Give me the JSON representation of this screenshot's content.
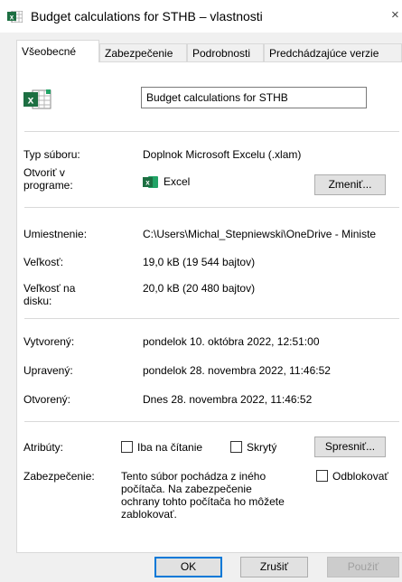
{
  "window": {
    "title": "Budget calculations for STHB – vlastnosti",
    "close_glyph": "×"
  },
  "tabs": [
    {
      "label": "Všeobecné",
      "active": true
    },
    {
      "label": "Zabezpečenie",
      "active": false
    },
    {
      "label": "Podrobnosti",
      "active": false
    },
    {
      "label": "Predchádzajúce verzie",
      "active": false
    }
  ],
  "general": {
    "file_name": "Budget calculations for STHB",
    "file_type_label": "Typ súboru:",
    "file_type_value": "Doplnok Microsoft Excelu (.xlam)",
    "opens_with_label_1": "Otvoriť v",
    "opens_with_label_2": "programe:",
    "opens_with_app": "Excel",
    "change_button": "Zmeniť...",
    "location_label": "Umiestnenie:",
    "location_value": "C:\\Users\\Michal_Stepniewski\\OneDrive - Ministe",
    "size_label": "Veľkosť:",
    "size_value": "19,0 kB (19 544 bajtov)",
    "size_on_disk_label_1": "Veľkosť na",
    "size_on_disk_label_2": "disku:",
    "size_on_disk_value": "20,0 kB (20 480 bajtov)",
    "created_label": "Vytvorený:",
    "created_value": "pondelok 10. októbra 2022, 12:51:00",
    "modified_label": "Upravený:",
    "modified_value": "pondelok 28. novembra 2022, 11:46:52",
    "accessed_label": "Otvorený:",
    "accessed_value": "Dnes 28. novembra 2022, 11:46:52",
    "attributes_label": "Atribúty:",
    "readonly_label": "Iba na čítanie",
    "readonly_checked": false,
    "hidden_label": "Skrytý",
    "hidden_checked": false,
    "advanced_button": "Spresniť...",
    "security_label": "Zabezpečenie:",
    "security_text_1": "Tento súbor pochádza z iného",
    "security_text_2": "počítača. Na zabezpečenie",
    "security_text_3": "ochrany tohto počítača ho môžete",
    "security_text_4": "zablokovať.",
    "unblock_label": "Odblokovať",
    "unblock_checked": false
  },
  "footer": {
    "ok": "OK",
    "cancel": "Zrušiť",
    "apply": "Použiť"
  },
  "colors": {
    "excel_green": "#1d6f42",
    "excel_green_light": "#21a366",
    "button_bg": "#e1e1e1",
    "ok_border": "#0078d7",
    "disabled_text": "#a0a0a0"
  },
  "icons": {
    "title": "excel-file-icon",
    "file": "excel-file-icon",
    "app": "excel-app-icon"
  }
}
